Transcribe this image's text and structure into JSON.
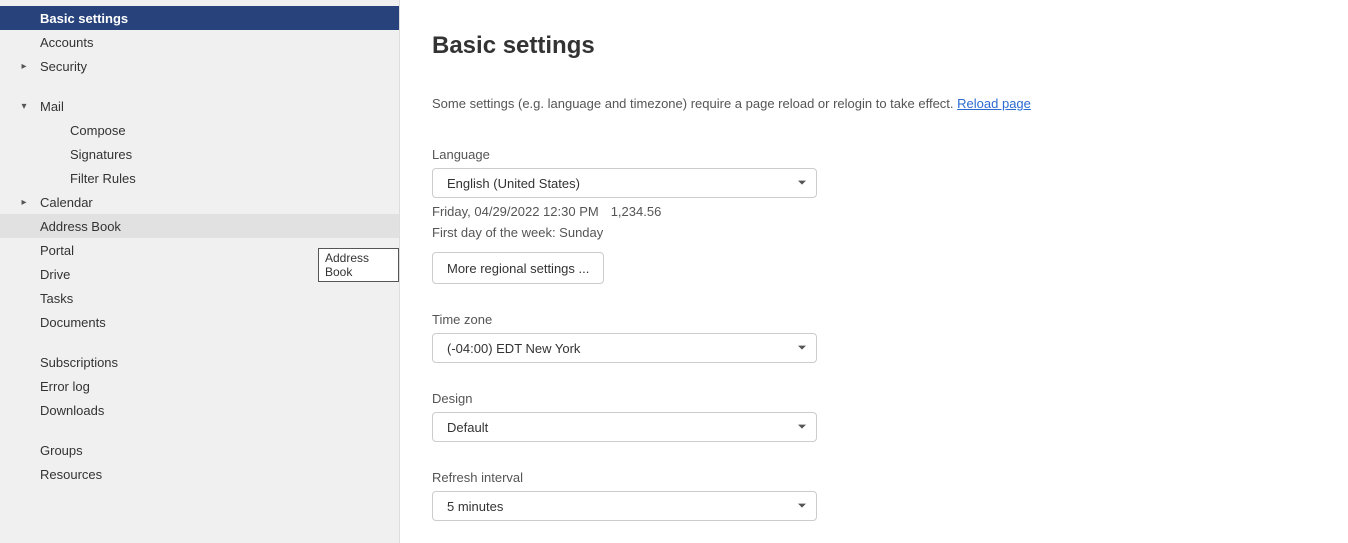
{
  "sidebar": {
    "items": [
      {
        "label": "Basic settings",
        "active": true
      },
      {
        "label": "Accounts"
      },
      {
        "label": "Security",
        "arrow": "right"
      },
      {
        "spacer": true
      },
      {
        "label": "Mail",
        "arrow": "down"
      },
      {
        "label": "Compose",
        "sub": true
      },
      {
        "label": "Signatures",
        "sub": true
      },
      {
        "label": "Filter Rules",
        "sub": true
      },
      {
        "label": "Calendar",
        "arrow": "right"
      },
      {
        "label": "Address Book",
        "hover": true
      },
      {
        "label": "Portal"
      },
      {
        "label": "Drive"
      },
      {
        "label": "Tasks"
      },
      {
        "label": "Documents"
      },
      {
        "spacer": true
      },
      {
        "label": "Subscriptions"
      },
      {
        "label": "Error log"
      },
      {
        "label": "Downloads"
      },
      {
        "spacer": true
      },
      {
        "label": "Groups"
      },
      {
        "label": "Resources"
      }
    ],
    "tooltip": "Address Book"
  },
  "main": {
    "title": "Basic settings",
    "notice_text": "Some settings (e.g. language and timezone) require a page reload or relogin to take effect. ",
    "notice_link": "Reload page",
    "language": {
      "label": "Language",
      "value": "English (United States)",
      "example_date": "Friday, 04/29/2022 12:30 PM",
      "example_number": "1,234.56",
      "first_day": "First day of the week: Sunday",
      "more_btn": "More regional settings ..."
    },
    "timezone": {
      "label": "Time zone",
      "value": "(-04:00) EDT New York"
    },
    "design": {
      "label": "Design",
      "value": "Default"
    },
    "refresh": {
      "label": "Refresh interval",
      "value": "5 minutes"
    }
  }
}
